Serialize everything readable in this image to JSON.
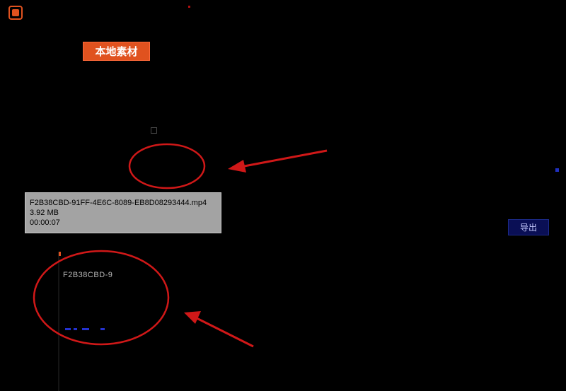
{
  "header": {
    "app_icon": "app-logo-icon"
  },
  "tabs": {
    "local_material_label": "本地素材"
  },
  "tooltip": {
    "filename": "F2B38CBD-91FF-4E6C-8089-EB8D08293444.mp4",
    "size": "3.92 MB",
    "duration": "00:00:07"
  },
  "timeline": {
    "clip_label": "F2B38CBD-9"
  },
  "actions": {
    "export_label": "导出"
  },
  "annotation_colors": {
    "circle": "#d01818",
    "arrow": "#d01818"
  }
}
